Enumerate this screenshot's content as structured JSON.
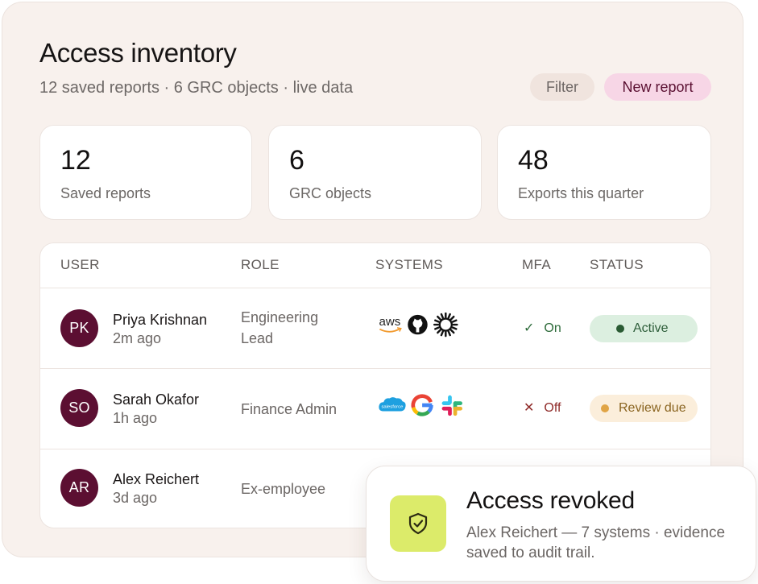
{
  "header": {
    "title": "Access inventory",
    "subtitle": "12 saved reports · 6 GRC objects · live data",
    "filter_label": "Filter",
    "new_report_label": "New report"
  },
  "stats": [
    {
      "value": "12",
      "label": "Saved reports"
    },
    {
      "value": "6",
      "label": "GRC objects"
    },
    {
      "value": "48",
      "label": "Exports this quarter"
    }
  ],
  "table": {
    "columns": [
      "USER",
      "ROLE",
      "SYSTEMS",
      "MFA",
      "STATUS"
    ],
    "rows": [
      {
        "initials": "PK",
        "name": "Priya Krishnan",
        "time": "2m ago",
        "role": "Engineering Lead",
        "systems": [
          "aws-logo-icon",
          "github-logo-icon",
          "sunburst-logo-icon"
        ],
        "mfa": "On",
        "status": "Active"
      },
      {
        "initials": "SO",
        "name": "Sarah Okafor",
        "time": "1h ago",
        "role": "Finance Admin",
        "systems": [
          "salesforce-logo-icon",
          "google-logo-icon",
          "slack-logo-icon"
        ],
        "mfa": "Off",
        "status": "Review due"
      },
      {
        "initials": "AR",
        "name": "Alex Reichert",
        "time": "3d ago",
        "role": "Ex-employee"
      }
    ]
  },
  "toast": {
    "title": "Access revoked",
    "body": "Alex Reichert — 7 systems · evidence saved to audit trail.",
    "icon": "shield-check-icon"
  },
  "systems_text": {
    "aws": "aws",
    "salesforce": "salesforce"
  },
  "colors": {
    "panel_bg": "#f8f1ed",
    "brand": "#5c0f32",
    "new_report_bg": "#f7d6e6",
    "active_bg": "#dcefe0",
    "review_bg": "#fbeedb",
    "toast_icon_bg": "#dceb6a"
  }
}
